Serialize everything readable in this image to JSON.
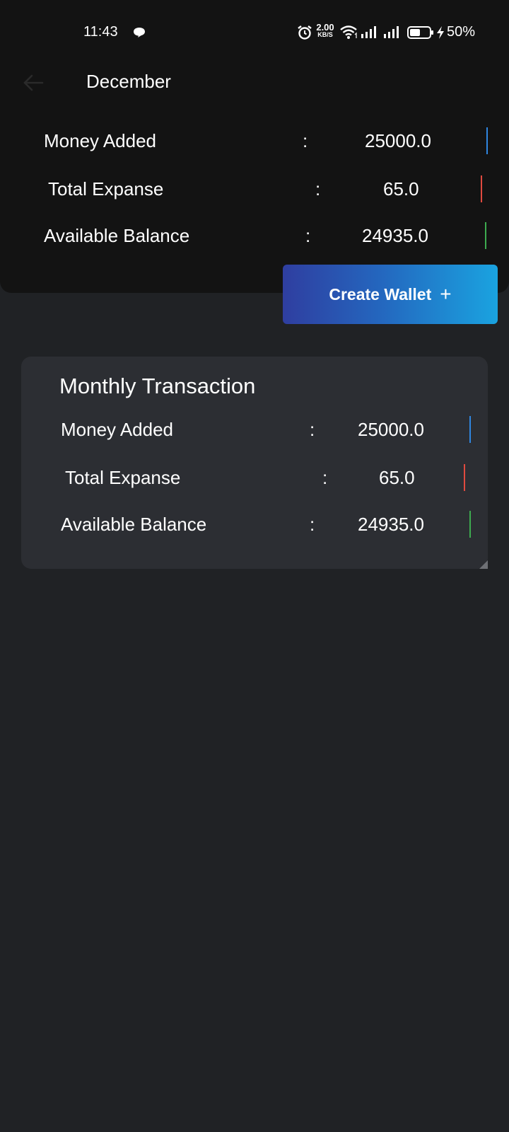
{
  "status_bar": {
    "time": "11:43",
    "net_speed_value": "2.00",
    "net_speed_unit": "KB/S",
    "battery_percent": "50%"
  },
  "header": {
    "title": "December",
    "summary": [
      {
        "label": "Money Added",
        "separator": ":",
        "value": "25000.0",
        "color": "#2f86e0"
      },
      {
        "label": "Total Expanse",
        "separator": ":",
        "value": "65.0",
        "color": "#e04a3f"
      },
      {
        "label": "Available Balance",
        "separator": ":",
        "value": "24935.0",
        "color": "#3dab4f"
      }
    ]
  },
  "create_wallet": {
    "label": "Create Wallet",
    "icon": "+"
  },
  "monthly": {
    "title": "Monthly Transaction",
    "rows": [
      {
        "label": "Money Added",
        "separator": ":",
        "value": "25000.0",
        "color": "#2f86e0"
      },
      {
        "label": "Total Expanse",
        "separator": ":",
        "value": "65.0",
        "color": "#e04a3f"
      },
      {
        "label": "Available Balance",
        "separator": ":",
        "value": "24935.0",
        "color": "#3dab4f"
      }
    ]
  },
  "colors": {
    "background": "#202225",
    "header_bg": "#131313",
    "card_bg": "#2c2e33",
    "button_gradient_start": "#2f3ea0",
    "button_gradient_end": "#1aa3e0"
  }
}
